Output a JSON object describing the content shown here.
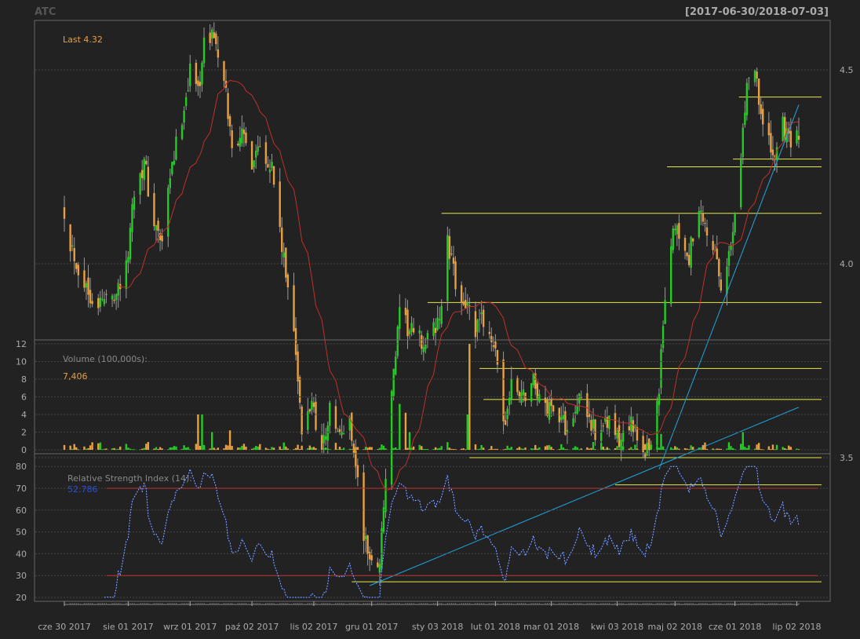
{
  "header": {
    "symbol": "ATC",
    "date_range": "[2017-06-30/2018-07-03]"
  },
  "colors": {
    "background": "#222222",
    "panel_border": "#666666",
    "grid": "#444444",
    "axis_text": "#aaaaaa",
    "candle_up": "#22cc22",
    "candle_down": "#e8a040",
    "sma": "#c0302a",
    "support_lines": "#e8e84a",
    "trend_lines": "#1fa6e0",
    "rsi_line": "#3a6cff",
    "rsi_bands": "#c0302a",
    "last_label": "#e8a040",
    "rsi_value": "#2a4fe0"
  },
  "chart_data": [
    {
      "type": "candlestick",
      "name": "price",
      "title": "",
      "last_label": "Last 4.32",
      "y_ticks": [
        "3.5",
        "4.0",
        "4.5"
      ],
      "ylim": [
        3.14,
        4.7
      ],
      "grid": true,
      "sma_period": 20,
      "date_start": "2017-06-30",
      "date_end": "2018-07-03",
      "anchors": [
        [
          "2017-06-30",
          4.14
        ],
        [
          "2017-07-03",
          4.06
        ],
        [
          "2017-07-07",
          3.99
        ],
        [
          "2017-07-12",
          3.93
        ],
        [
          "2017-07-18",
          3.9
        ],
        [
          "2017-07-24",
          3.92
        ],
        [
          "2017-07-31",
          3.98
        ],
        [
          "2017-08-04",
          4.2
        ],
        [
          "2017-08-09",
          4.26
        ],
        [
          "2017-08-14",
          4.1
        ],
        [
          "2017-08-18",
          4.05
        ],
        [
          "2017-08-23",
          4.25
        ],
        [
          "2017-08-28",
          4.38
        ],
        [
          "2017-09-01",
          4.5
        ],
        [
          "2017-09-05",
          4.45
        ],
        [
          "2017-09-08",
          4.56
        ],
        [
          "2017-09-13",
          4.6
        ],
        [
          "2017-09-15",
          4.52
        ],
        [
          "2017-09-19",
          4.43
        ],
        [
          "2017-09-22",
          4.3
        ],
        [
          "2017-09-26",
          4.34
        ],
        [
          "2017-10-02",
          4.27
        ],
        [
          "2017-10-06",
          4.32
        ],
        [
          "2017-10-12",
          4.25
        ],
        [
          "2017-10-18",
          4.0
        ],
        [
          "2017-10-23",
          3.85
        ],
        [
          "2017-10-27",
          3.55
        ],
        [
          "2017-11-01",
          3.65
        ],
        [
          "2017-11-06",
          3.52
        ],
        [
          "2017-11-10",
          3.62
        ],
        [
          "2017-11-15",
          3.55
        ],
        [
          "2017-11-20",
          3.6
        ],
        [
          "2017-11-23",
          3.48
        ],
        [
          "2017-11-27",
          3.3
        ],
        [
          "2017-12-01",
          3.22
        ],
        [
          "2017-12-05",
          3.24
        ],
        [
          "2017-12-08",
          3.45
        ],
        [
          "2017-12-12",
          3.72
        ],
        [
          "2017-12-15",
          3.86
        ],
        [
          "2017-12-21",
          3.82
        ],
        [
          "2017-12-28",
          3.79
        ],
        [
          "2018-01-04",
          3.86
        ],
        [
          "2018-01-08",
          4.05
        ],
        [
          "2018-01-12",
          3.95
        ],
        [
          "2018-01-17",
          3.9
        ],
        [
          "2018-01-22",
          3.82
        ],
        [
          "2018-01-26",
          3.86
        ],
        [
          "2018-01-31",
          3.8
        ],
        [
          "2018-02-05",
          3.58
        ],
        [
          "2018-02-09",
          3.68
        ],
        [
          "2018-02-15",
          3.66
        ],
        [
          "2018-02-20",
          3.7
        ],
        [
          "2018-02-26",
          3.62
        ],
        [
          "2018-03-02",
          3.64
        ],
        [
          "2018-03-08",
          3.58
        ],
        [
          "2018-03-14",
          3.65
        ],
        [
          "2018-03-20",
          3.6
        ],
        [
          "2018-03-26",
          3.55
        ],
        [
          "2018-03-30",
          3.6
        ],
        [
          "2018-04-04",
          3.53
        ],
        [
          "2018-04-09",
          3.6
        ],
        [
          "2018-04-13",
          3.54
        ],
        [
          "2018-04-19",
          3.52
        ],
        [
          "2018-04-24",
          3.68
        ],
        [
          "2018-04-27",
          3.92
        ],
        [
          "2018-05-02",
          4.1
        ],
        [
          "2018-05-08",
          4.0
        ],
        [
          "2018-05-14",
          4.12
        ],
        [
          "2018-05-21",
          4.05
        ],
        [
          "2018-05-25",
          3.92
        ],
        [
          "2018-05-30",
          4.05
        ],
        [
          "2018-06-04",
          4.3
        ],
        [
          "2018-06-08",
          4.5
        ],
        [
          "2018-06-12",
          4.48
        ],
        [
          "2018-06-15",
          4.35
        ],
        [
          "2018-06-20",
          4.28
        ],
        [
          "2018-06-25",
          4.35
        ],
        [
          "2018-06-29",
          4.3
        ],
        [
          "2018-07-03",
          4.32
        ]
      ],
      "horizontal_levels": [
        {
          "y": 4.43,
          "from": "2018-06-03"
        },
        {
          "y": 4.27,
          "from": "2018-05-31"
        },
        {
          "y": 4.25,
          "from": "2018-04-28"
        },
        {
          "y": 4.13,
          "from": "2018-01-05"
        },
        {
          "y": 3.9,
          "from": "2017-12-29"
        },
        {
          "y": 3.73,
          "from": "2018-01-24"
        },
        {
          "y": 3.65,
          "from": "2018-01-26"
        },
        {
          "y": 3.5,
          "from": "2018-01-19"
        },
        {
          "y": 3.43,
          "from": "2018-04-02"
        },
        {
          "y": 3.18,
          "from": "2017-11-21"
        }
      ],
      "trend_lines": [
        {
          "from": [
            "2017-11-30",
            3.17
          ],
          "to": [
            "2018-07-03",
            3.63
          ]
        },
        {
          "from": [
            "2018-04-24",
            3.47
          ],
          "to": [
            "2018-07-03",
            4.41
          ]
        }
      ]
    },
    {
      "type": "bar",
      "name": "volume",
      "label": "Volume (100,000s):",
      "last_value": "7,406",
      "y_ticks": [
        "0",
        "2",
        "4",
        "6",
        "8",
        "10",
        "12"
      ],
      "ylim": [
        0,
        12
      ],
      "spikes": [
        {
          "date": "2017-09-05",
          "value": 4.0
        },
        {
          "date": "2017-09-07",
          "value": 4.0
        },
        {
          "date": "2017-09-12",
          "value": 2.0
        },
        {
          "date": "2017-09-21",
          "value": 2.2
        },
        {
          "date": "2017-12-15",
          "value": 5.2
        },
        {
          "date": "2017-12-18",
          "value": 4.2
        },
        {
          "date": "2017-12-20",
          "value": 2.0
        },
        {
          "date": "2018-01-19",
          "value": 12.0
        },
        {
          "date": "2018-01-18",
          "value": 4.0
        },
        {
          "date": "2018-04-25",
          "value": 1.8
        },
        {
          "date": "2018-06-05",
          "value": 2.0
        }
      ]
    },
    {
      "type": "line",
      "name": "rsi",
      "label": "Relative Strength Index (14):",
      "last_value": "52.786",
      "y_ticks": [
        "20",
        "30",
        "40",
        "50",
        "60",
        "70",
        "80"
      ],
      "ylim": [
        20,
        80
      ],
      "bands": [
        70,
        30
      ]
    }
  ],
  "x_axis": {
    "ticks": [
      {
        "date": "2017-06-30",
        "label": "cze 30 2017"
      },
      {
        "date": "2017-08-01",
        "label": "sie 01 2017"
      },
      {
        "date": "2017-09-01",
        "label": "wrz 01 2017"
      },
      {
        "date": "2017-10-02",
        "label": "paź 02 2017"
      },
      {
        "date": "2017-11-02",
        "label": "lis 02 2017"
      },
      {
        "date": "2017-12-01",
        "label": "gru 01 2017"
      },
      {
        "date": "2018-01-03",
        "label": "sty 03 2018"
      },
      {
        "date": "2018-02-01",
        "label": "lut 01 2018"
      },
      {
        "date": "2018-03-01",
        "label": "mar 01 2018"
      },
      {
        "date": "2018-04-03",
        "label": "kwi 03 2018"
      },
      {
        "date": "2018-05-02",
        "label": "maj 02 2018"
      },
      {
        "date": "2018-06-01",
        "label": "cze 01 2018"
      },
      {
        "date": "2018-07-02",
        "label": "lip 02 2018"
      }
    ]
  }
}
